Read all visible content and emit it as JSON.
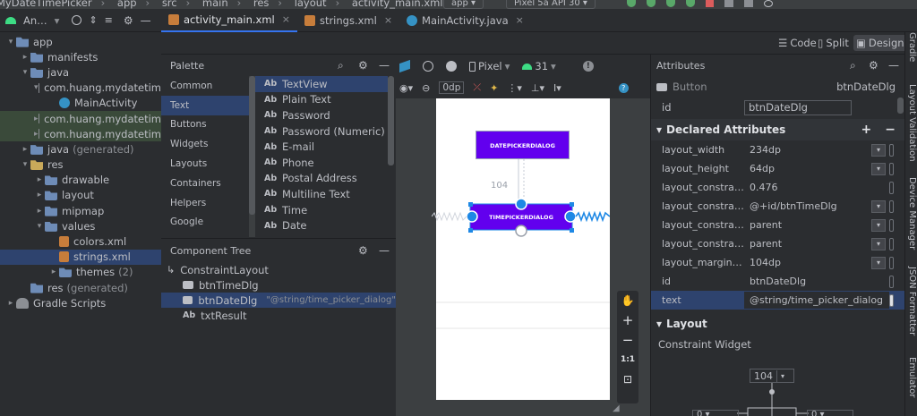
{
  "topbar": {
    "crumbs": [
      "MyDateTimePicker",
      "app",
      "src",
      "main",
      "res",
      "layout",
      "activity_main.xml"
    ],
    "module": "app",
    "device": "Pixel 5a API 30"
  },
  "project": {
    "view": "An…",
    "items": [
      {
        "label": "app",
        "depth": 0,
        "arrow": "▾",
        "icon": "folder-app"
      },
      {
        "label": "manifests",
        "depth": 1,
        "arrow": "▸",
        "icon": "folder"
      },
      {
        "label": "java",
        "depth": 1,
        "arrow": "▾",
        "icon": "folder"
      },
      {
        "label": "com.huang.mydatetim",
        "depth": 2,
        "arrow": "▾",
        "icon": "package"
      },
      {
        "label": "MainActivity",
        "depth": 3,
        "arrow": "",
        "icon": "class"
      },
      {
        "label": "com.huang.mydatetim",
        "depth": 2,
        "arrow": "▸",
        "icon": "package",
        "hl": true
      },
      {
        "label": "com.huang.mydatetim",
        "depth": 2,
        "arrow": "▸",
        "icon": "package",
        "hl": true
      },
      {
        "label": "java",
        "suffix": "(generated)",
        "depth": 1,
        "arrow": "▸",
        "icon": "folder"
      },
      {
        "label": "res",
        "depth": 1,
        "arrow": "▾",
        "icon": "folder-y"
      },
      {
        "label": "drawable",
        "depth": 2,
        "arrow": "▸",
        "icon": "folder"
      },
      {
        "label": "layout",
        "depth": 2,
        "arrow": "▸",
        "icon": "folder"
      },
      {
        "label": "mipmap",
        "depth": 2,
        "arrow": "▸",
        "icon": "folder"
      },
      {
        "label": "values",
        "depth": 2,
        "arrow": "▾",
        "icon": "folder"
      },
      {
        "label": "colors.xml",
        "depth": 3,
        "arrow": "",
        "icon": "xml"
      },
      {
        "label": "strings.xml",
        "depth": 3,
        "arrow": "",
        "icon": "xml",
        "sel": true
      },
      {
        "label": "themes",
        "suffix": "(2)",
        "depth": 3,
        "arrow": "▸",
        "icon": "folder"
      },
      {
        "label": "res",
        "suffix": "(generated)",
        "depth": 1,
        "arrow": "",
        "icon": "folder"
      },
      {
        "label": "Gradle Scripts",
        "depth": 0,
        "arrow": "▸",
        "icon": "gradle"
      }
    ]
  },
  "tabs": [
    {
      "label": "activity_main.xml",
      "type": "xml",
      "active": true
    },
    {
      "label": "strings.xml",
      "type": "xml",
      "active": false
    },
    {
      "label": "MainActivity.java",
      "type": "java",
      "active": false
    }
  ],
  "modes": {
    "code": "Code",
    "split": "Split",
    "design": "Design"
  },
  "palette": {
    "title": "Palette",
    "categories": [
      "Common",
      "Text",
      "Buttons",
      "Widgets",
      "Layouts",
      "Containers",
      "Helpers",
      "Google"
    ],
    "selected_category": "Text",
    "items": [
      "TextView",
      "Plain Text",
      "Password",
      "Password (Numeric)",
      "E-mail",
      "Phone",
      "Postal Address",
      "Multiline Text",
      "Time",
      "Date"
    ],
    "item_prefix": "Ab",
    "selected_item": "TextView"
  },
  "component_tree": {
    "title": "Component Tree",
    "root": "ConstraintLayout",
    "children": [
      {
        "label": "btnTimeDlg",
        "type": "button",
        "hint": ""
      },
      {
        "label": "btnDateDlg",
        "type": "button",
        "hint": "\"@string/time_picker_dialog\"",
        "sel": true
      },
      {
        "label": "txtResult",
        "type": "text",
        "hint": ""
      }
    ]
  },
  "design_toolbar": {
    "device": "Pixel",
    "api": "31",
    "margin": "0dp"
  },
  "canvas": {
    "date_button": "DATEPICKERDIALOG",
    "time_button": "TIMEPICKERDIALOG",
    "margin_label": "104",
    "accent": "#6200ee",
    "handle_color": "#1e88e5",
    "zoom_label": "1:1"
  },
  "attributes": {
    "title": "Attributes",
    "widget_type": "Button",
    "widget_id": "btnDateDlg",
    "id_label": "id",
    "id_value": "btnDateDlg",
    "declared_title": "Declared Attributes",
    "declared": [
      {
        "k": "layout_width",
        "v": "234dp",
        "dd": true
      },
      {
        "k": "layout_height",
        "v": "64dp",
        "dd": true
      },
      {
        "k": "layout_constraintHo…",
        "v": "0.476",
        "dd": false
      },
      {
        "k": "layout_constraintTo…",
        "v": "@+id/btnTimeDlg",
        "dd": true
      },
      {
        "k": "layout_constraintEn…",
        "v": "parent",
        "dd": true
      },
      {
        "k": "layout_constraintSta…",
        "v": "parent",
        "dd": true
      },
      {
        "k": "layout_marginTop",
        "v": "104dp",
        "dd": true
      },
      {
        "k": "id",
        "v": "btnDateDlg",
        "dd": false
      },
      {
        "k": "text",
        "v": "@string/time_picker_dialog",
        "dd": false,
        "sel": true
      }
    ],
    "layout_title": "Layout",
    "constraint_widget": "Constraint Widget",
    "top_margin": "104",
    "side_margin_left": "0",
    "side_margin_right": "0"
  },
  "right_sidebar": [
    "Gradle",
    "Layout Validation",
    "Device Manager",
    "JSON Formatter",
    "Emulator"
  ]
}
